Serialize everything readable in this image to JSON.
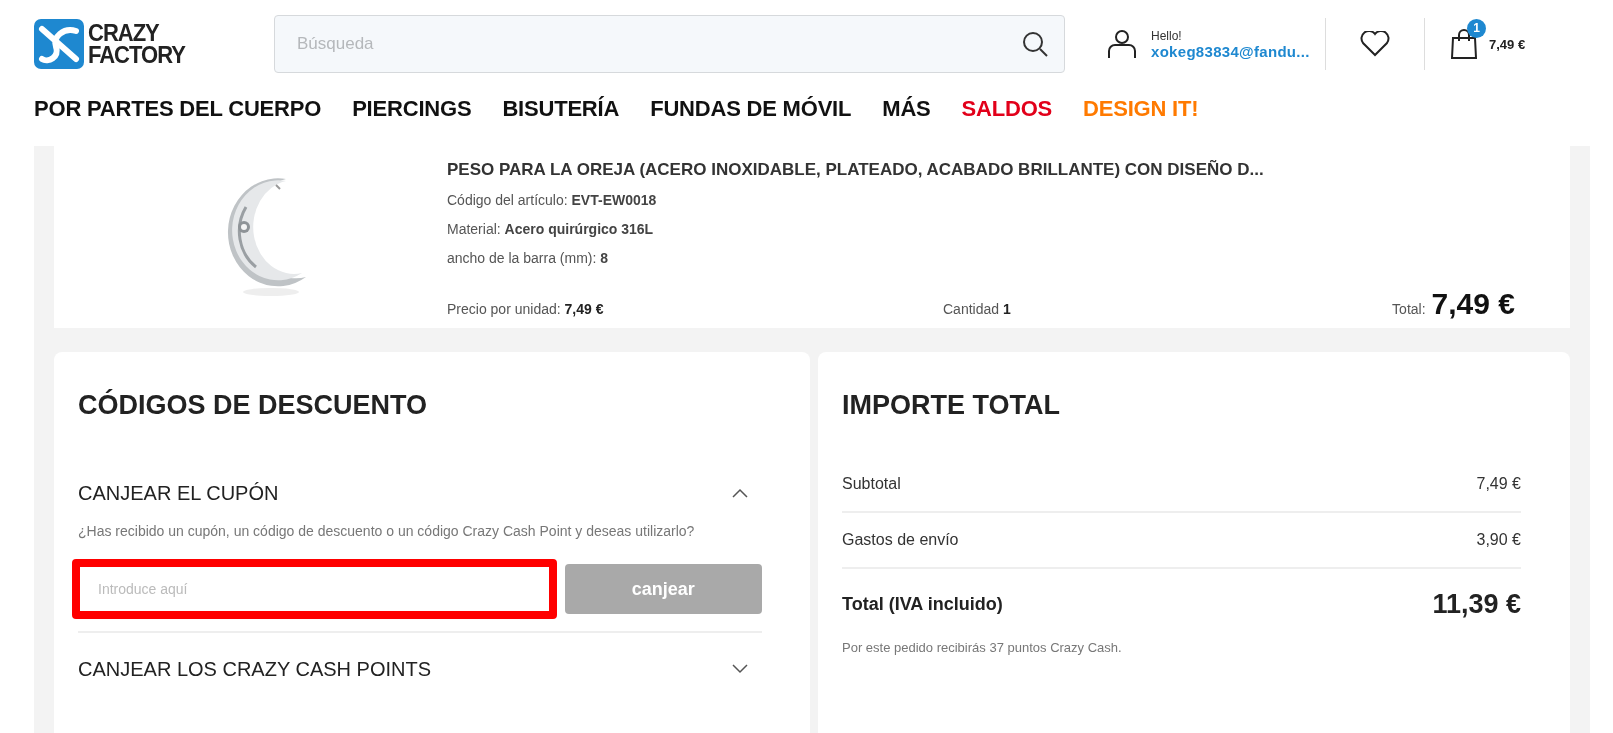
{
  "header": {
    "logo": "CRAZY FACTORY",
    "search": {
      "placeholder": "Búsqueda"
    },
    "account": {
      "greeting": "Hello!",
      "email": "xokeg83834@fandu..."
    },
    "cart": {
      "count": "1",
      "amount": "7,49 €"
    }
  },
  "nav": [
    {
      "label": "POR PARTES DEL CUERPO",
      "color": "#111111"
    },
    {
      "label": "PIERCINGS",
      "color": "#111111"
    },
    {
      "label": "BISUTERÍA",
      "color": "#111111"
    },
    {
      "label": "FUNDAS DE MÓVIL",
      "color": "#111111"
    },
    {
      "label": "MÁS",
      "color": "#111111"
    },
    {
      "label": "SALDOS",
      "color": "#e2001a"
    },
    {
      "label": "DESIGN IT!",
      "color": "#ff7a00"
    }
  ],
  "product": {
    "title": "PESO PARA LA OREJA (ACERO INOXIDABLE, PLATEADO, ACABADO BRILLANTE) CON DISEÑO D...",
    "details": [
      {
        "label": "Código del artículo:",
        "value": "EVT-EW0018"
      },
      {
        "label": "Material:",
        "value": "Acero quirúrgico 316L"
      },
      {
        "label": "ancho de la barra (mm):",
        "value": "8"
      }
    ],
    "unit_price_label": "Precio por unidad:",
    "unit_price": "7,49 €",
    "quantity_label": "Cantidad",
    "quantity": "1",
    "total_label": "Total:",
    "total": "7,49 €"
  },
  "discounts": {
    "title": "CÓDIGOS DE DESCUENTO",
    "sections": [
      {
        "title": "CANJEAR EL CUPÓN",
        "expanded": true,
        "text": "¿Has recibido un cupón, un código de descuento o un código Crazy Cash Point y deseas utilizarlo?",
        "field": {
          "placeholder": "Introduce aquí",
          "highlighted": true
        },
        "button": {
          "label": "canjear",
          "disabled": true
        }
      },
      {
        "title": "CANJEAR LOS CRAZY CASH POINTS",
        "expanded": false
      }
    ]
  },
  "summary": {
    "title": "IMPORTE TOTAL",
    "rows": [
      {
        "label": "Subtotal",
        "value": "7,49 €"
      },
      {
        "label": "Gastos de envío",
        "value": "3,90 €"
      }
    ],
    "total_label": "Total (IVA incluido)",
    "total": "11,39 €",
    "note": "Por este pedido recibirás 37 puntos Crazy Cash."
  }
}
